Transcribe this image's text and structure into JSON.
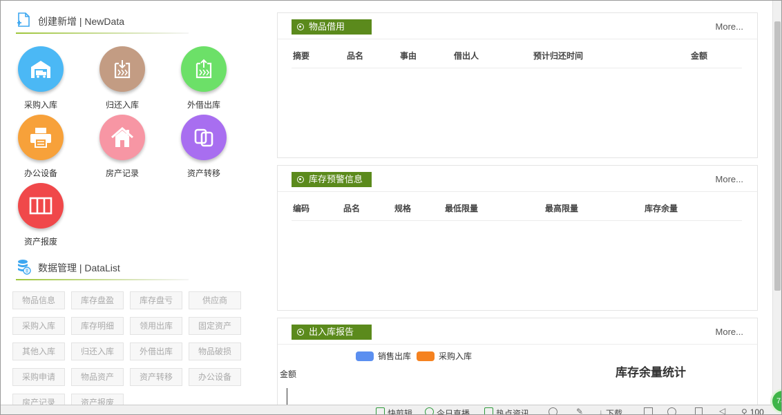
{
  "new_section": {
    "title": "创建新增 | NewData"
  },
  "tiles": [
    {
      "label": "采购入库",
      "color": "#4bb8f5",
      "icon": "warehouse-truck-icon"
    },
    {
      "label": "归还入库",
      "color": "#c39c83",
      "icon": "return-box-icon"
    },
    {
      "label": "外借出库",
      "color": "#6ce068",
      "icon": "lend-box-icon"
    },
    {
      "label": "办公设备",
      "color": "#f7a13a",
      "icon": "printer-icon"
    },
    {
      "label": "房产记录",
      "color": "#f796a4",
      "icon": "house-icon"
    },
    {
      "label": "资产转移",
      "color": "#a86ef0",
      "icon": "transfer-icon"
    },
    {
      "label": "资产报废",
      "color": "#f0484a",
      "icon": "scrap-icon"
    }
  ],
  "data_section": {
    "title": "数据管理 | DataList"
  },
  "data_buttons": [
    "物品信息",
    "库存盘盈",
    "库存盘亏",
    "供应商",
    "采购入库",
    "库存明细",
    "领用出库",
    "固定资产",
    "其他入库",
    "归还入库",
    "外借出库",
    "物品破损",
    "采购申请",
    "物品资产",
    "资产转移",
    "办公设备",
    "房产记录",
    "资产报废"
  ],
  "panels": {
    "borrow": {
      "title": "物品借用",
      "more": "More...",
      "columns": [
        "摘要",
        "品名",
        "事由",
        "借出人",
        "预计归还时间",
        "金额"
      ]
    },
    "alert": {
      "title": "库存预警信息",
      "more": "More...",
      "columns": [
        "编码",
        "品名",
        "规格",
        "最低限量",
        "最高限量",
        "库存余量"
      ]
    },
    "report": {
      "title": "出入库报告",
      "more": "More..."
    }
  },
  "chart_data": {
    "type": "bar",
    "title": "库存余量统计",
    "ylabel": "金额",
    "series": [
      {
        "name": "销售出库",
        "color": "#5b8ff0"
      },
      {
        "name": "采购入库",
        "color": "#f58220"
      }
    ]
  },
  "taskbar": {
    "items": [
      "快剪辑",
      "今日直播",
      "热点资讯",
      "下载",
      "100"
    ]
  },
  "colors": {
    "accent": "#5b8a1c"
  }
}
